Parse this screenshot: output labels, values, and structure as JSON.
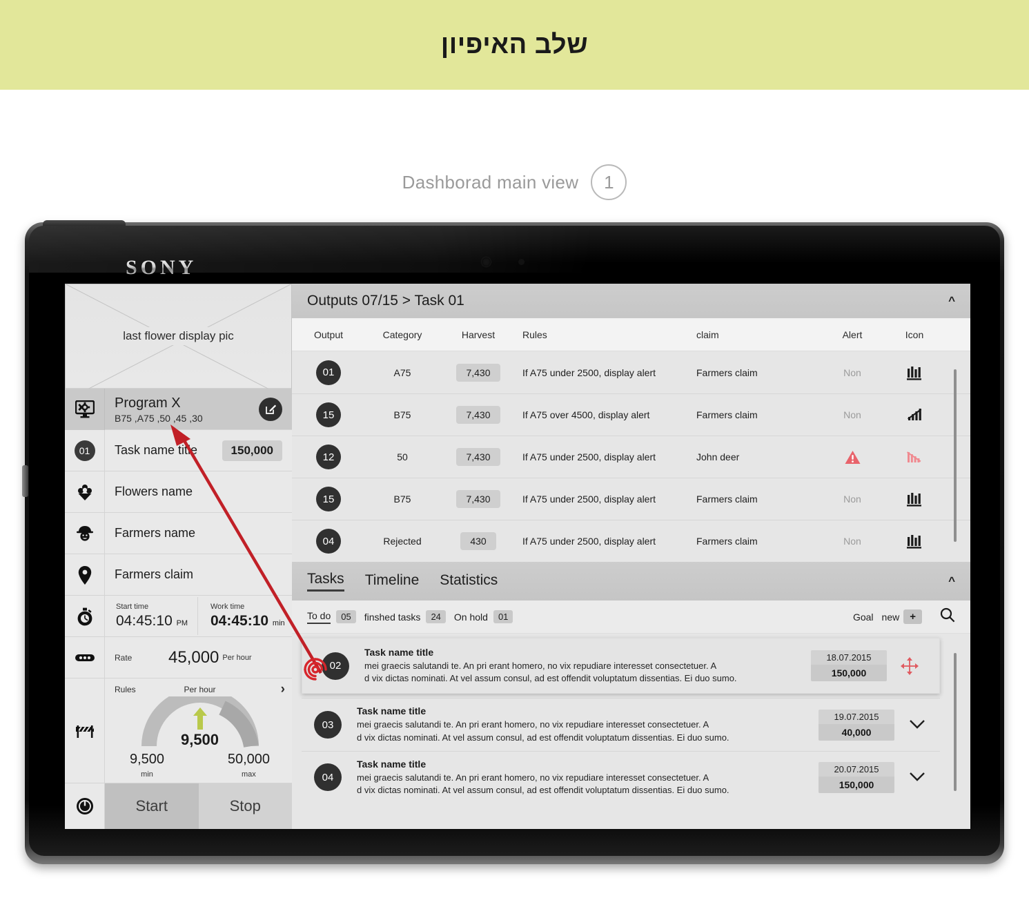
{
  "banner": {
    "title": "שלב האיפיון"
  },
  "caption": {
    "text": "Dashborad main view",
    "number": "1"
  },
  "device": {
    "brand": "SONY"
  },
  "left_panel": {
    "image_placeholder": "last flower display pic",
    "program": {
      "title": "Program X",
      "subtitle": "B75 ,A75 ,50 ,45 ,30",
      "edit_icon": "edit-icon"
    },
    "task_row": {
      "badge": "01",
      "label": "Task name title",
      "value": "150,000"
    },
    "flowers_row": {
      "label": "Flowers name",
      "icon": "flower-icon"
    },
    "farmers_row": {
      "label": "Farmers name",
      "icon": "farmer-icon"
    },
    "claim_row": {
      "label": "Farmers claim",
      "icon": "location-pin-icon"
    },
    "time_row": {
      "icon": "stopwatch-icon",
      "start_label": "Start time",
      "start_value": "04:45:10",
      "start_unit": "PM",
      "work_label": "Work time",
      "work_value": "04:45:10",
      "work_unit": "min"
    },
    "rate_row": {
      "icon": "rate-icon",
      "label": "Rate",
      "value": "45,000",
      "unit": "Per hour"
    },
    "rules_row": {
      "icon": "barrier-icon",
      "label": "Rules",
      "gauge_label": "Per hour",
      "chevron": "chevron-right-icon",
      "value": "9,500",
      "min_value": "9,500",
      "min_label": "min",
      "max_value": "50,000",
      "max_label": "max",
      "arrow_color": "#b9c94b"
    },
    "controls": {
      "icon": "power-icon",
      "start": "Start",
      "stop": "Stop"
    }
  },
  "outputs": {
    "title": "Outputs  07/15 > Task 01",
    "collapse_icon": "chevron-up-icon",
    "columns": [
      "Output",
      "Category",
      "Harvest",
      "Rules",
      "claim",
      "Alert",
      "Icon"
    ],
    "rows": [
      {
        "output": "01",
        "category": "A75",
        "harvest": "7,430",
        "rules": "If A75 under 2500, display alert",
        "claim": "Farmers claim",
        "alert": "Non",
        "alert_state": "none",
        "icon": "bar-chart-icon"
      },
      {
        "output": "15",
        "category": "B75",
        "harvest": "7,430",
        "rules": "If A75 over 4500, display alert",
        "claim": "Farmers claim",
        "alert": "Non",
        "alert_state": "none",
        "icon": "bar-chart-rising-icon"
      },
      {
        "output": "12",
        "category": "50",
        "harvest": "7,430",
        "rules": "If A75 under 2500, display alert",
        "claim": "John deer",
        "alert": "",
        "alert_state": "warning",
        "icon": "bar-chart-falling-icon"
      },
      {
        "output": "15",
        "category": "B75",
        "harvest": "7,430",
        "rules": "If A75 under 2500, display alert",
        "claim": "Farmers claim",
        "alert": "Non",
        "alert_state": "none",
        "icon": "bar-chart-icon"
      },
      {
        "output": "04",
        "category": "Rejected",
        "harvest": "430",
        "rules": "If A75 under 2500, display alert",
        "claim": "Farmers claim",
        "alert": "Non",
        "alert_state": "none",
        "icon": "bar-chart-icon"
      }
    ]
  },
  "tasks_section": {
    "tabs": [
      {
        "label": "Tasks",
        "active": true
      },
      {
        "label": "Timeline",
        "active": false
      },
      {
        "label": "Statistics",
        "active": false
      }
    ],
    "collapse_icon": "chevron-up-icon",
    "filters": [
      {
        "label": "To do",
        "count": "05",
        "active": true
      },
      {
        "label": "finshed tasks",
        "count": "24",
        "active": false
      },
      {
        "label": "On hold",
        "count": "01",
        "active": false
      }
    ],
    "goal_label": "Goal",
    "new_label": "new",
    "new_plus": "+",
    "search_icon": "search-icon",
    "items": [
      {
        "num": "02",
        "title": "Task name title",
        "desc_line1": "mei graecis salutandi te. An pri erant homero, no vix repudiare interesset consectetuer. A",
        "desc_line2": "d vix dictas nominati. At vel assum consul, ad est offendit voluptatum dissentias. Ei duo sumo.",
        "date": "18.07.2015",
        "amount": "150,000",
        "action_icon": "move-arrows-icon",
        "selected": true
      },
      {
        "num": "03",
        "title": "Task name title",
        "desc_line1": "mei graecis salutandi te. An pri erant homero, no vix repudiare interesset consectetuer. A",
        "desc_line2": "d vix dictas nominati. At vel assum consul, ad est offendit voluptatum dissentias. Ei duo sumo.",
        "date": "19.07.2015",
        "amount": "40,000",
        "action_icon": "chevron-down-icon",
        "selected": false
      },
      {
        "num": "04",
        "title": "Task name title",
        "desc_line1": "mei graecis salutandi te. An pri erant homero, no vix repudiare interesset consectetuer. A",
        "desc_line2": "d vix dictas nominati. At vel assum consul, ad est offendit voluptatum dissentias. Ei duo sumo.",
        "date": "20.07.2015",
        "amount": "150,000",
        "action_icon": "chevron-down-icon",
        "selected": false
      }
    ]
  },
  "annotation": {
    "marker_icon": "fingerprint-icon",
    "arrow_color": "#c12027"
  }
}
